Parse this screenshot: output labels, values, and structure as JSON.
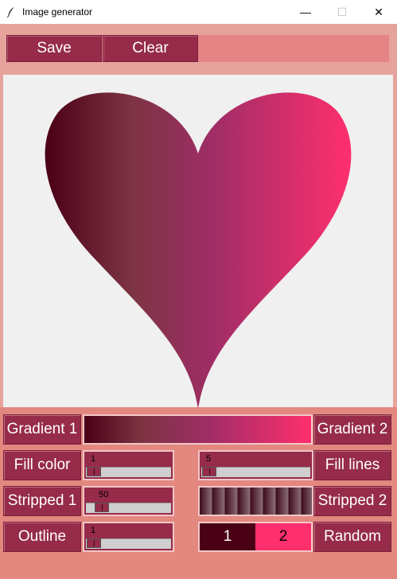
{
  "window": {
    "title": "Image generator"
  },
  "toolbar": {
    "save_label": "Save",
    "clear_label": "Clear"
  },
  "controls": {
    "gradient1_label": "Gradient 1",
    "gradient2_label": "Gradient 2",
    "fill_color_label": "Fill color",
    "fill_lines_label": "Fill lines",
    "stripped1_label": "Stripped 1",
    "stripped2_label": "Stripped 2",
    "outline_label": "Outline",
    "random_label": "Random",
    "fill_color_value": "1",
    "fill_lines_value": "5",
    "stripped1_value": "50",
    "outline_value": "1",
    "swatch1_label": "1",
    "swatch2_label": "2"
  },
  "colors": {
    "gradient_start": "#4a0016",
    "gradient_end": "#ff2f6e",
    "button": "#962b4a",
    "background": "#e3887f"
  },
  "icons": [
    "feather-icon",
    "minimize-icon",
    "maximize-icon",
    "close-icon",
    "heart-shape"
  ]
}
